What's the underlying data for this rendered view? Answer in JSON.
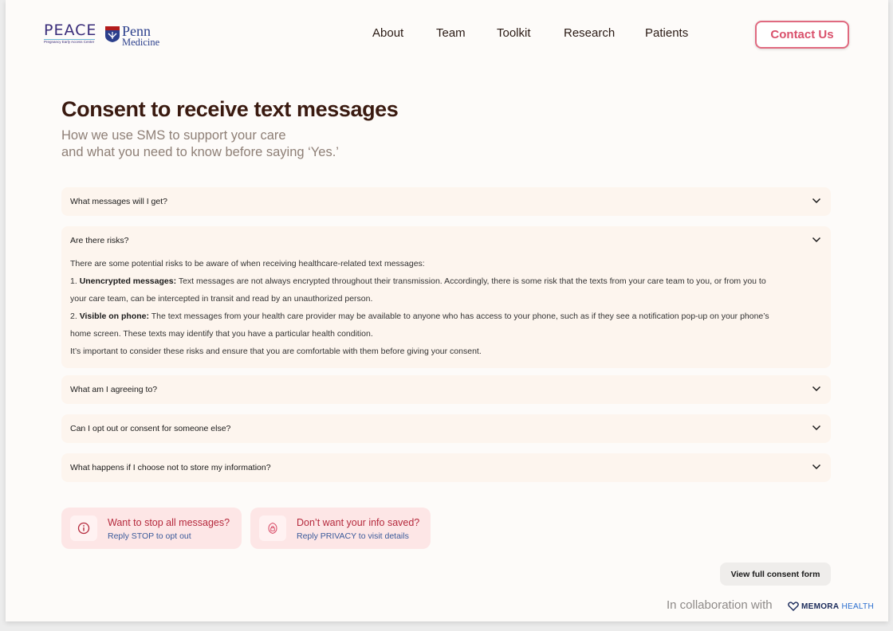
{
  "header": {
    "logo_peace": {
      "word": "PEACE",
      "tagline": "Pregnancy Early Access Center"
    },
    "logo_penn": {
      "line1": "Penn",
      "line2": "Medicine"
    },
    "nav": [
      "About",
      "Team",
      "Toolkit",
      "Research",
      "Patients"
    ],
    "contact_label": "Contact Us"
  },
  "main": {
    "title": "Consent to receive text messages",
    "subtitle_line1": "How we use SMS to support your care",
    "subtitle_line2": "and what you need to know before saying ‘Yes.’"
  },
  "faq": [
    {
      "question": "What messages will I get?",
      "expanded": false
    },
    {
      "question": "Are there risks?",
      "expanded": true,
      "intro": "There are some potential risks to be aware of when receiving healthcare-related text messages:",
      "point1_label": "Unencrypted messages:",
      "point1_text_a": "Text messages are not always encrypted throughout their transmission. Accordingly, there is some risk that the texts from your care team to you, or from you to",
      "point1_text_b": "your care team, can be intercepted in transit and read by an unauthorized person.",
      "point2_label": "Visible on phone:",
      "point2_text_a": "The text messages from your health care provider may be available to anyone who has access to your phone, such as if they see a notification pop-up on your phone’s",
      "point2_text_b": "home screen. These texts may identify that you have a particular health condition.",
      "closing": "It’s important to consider these risks and ensure that you are comfortable with them before giving your consent."
    },
    {
      "question": "What am I agreeing to?",
      "expanded": false
    },
    {
      "question": "Can I opt out or consent for someone else?",
      "expanded": false
    },
    {
      "question": "What happens if I choose not to store my information?",
      "expanded": false
    }
  ],
  "help_cards": [
    {
      "heading": "Want to stop all messages?",
      "sub": "Reply STOP to opt out",
      "icon": "info-icon"
    },
    {
      "heading": "Don’t want your info saved?",
      "sub": "Reply PRIVACY to visit details",
      "icon": "lock-icon"
    }
  ],
  "footer": {
    "consent_button": "View full consent form",
    "collab_text": "In collaboration with",
    "memora_word1": "MEMORA",
    "memora_word2": "HEALTH"
  },
  "colors": {
    "accent": "#d9506b",
    "accordion_bg": "#fdf5ee",
    "card_bg": "#fde6e6",
    "title": "#3a1a10"
  }
}
